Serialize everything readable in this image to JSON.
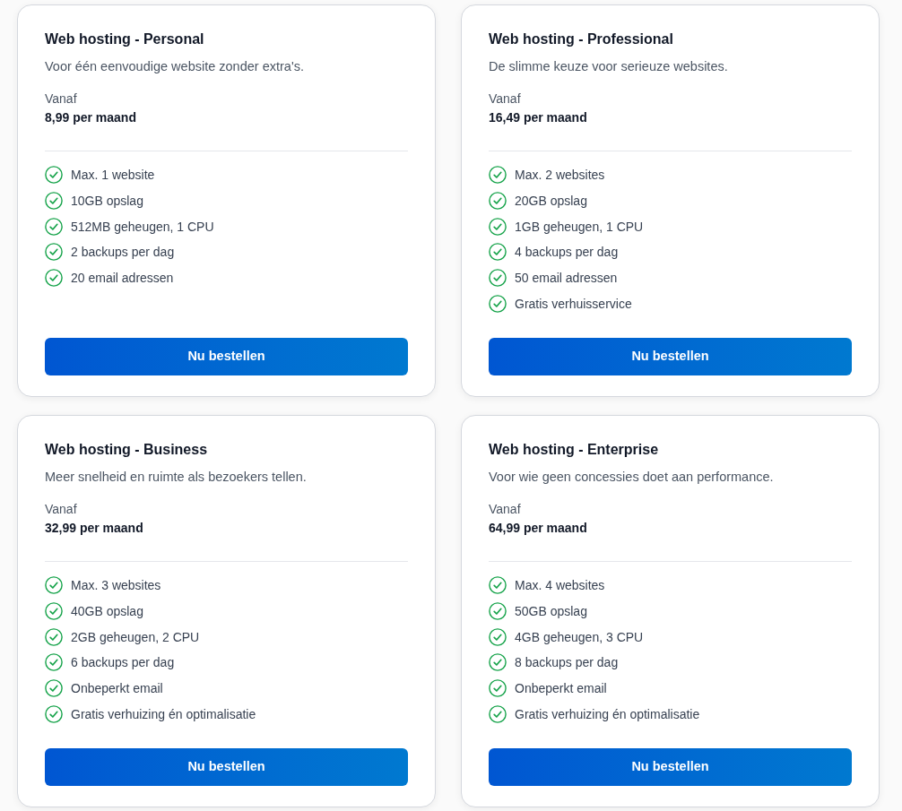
{
  "plans": [
    {
      "title": "Web hosting - Personal",
      "description": "Voor één eenvoudige website zonder extra's.",
      "price_label": "Vanaf",
      "price": "8,99 per maand",
      "features": [
        "Max. 1 website",
        "10GB opslag",
        "512MB geheugen, 1 CPU",
        "2 backups per dag",
        "20 email adressen"
      ],
      "button": "Nu bestellen"
    },
    {
      "title": "Web hosting - Professional",
      "description": "De slimme keuze voor serieuze websites.",
      "price_label": "Vanaf",
      "price": "16,49 per maand",
      "features": [
        "Max. 2 websites",
        "20GB opslag",
        "1GB geheugen, 1 CPU",
        "4 backups per dag",
        "50 email adressen",
        "Gratis verhuisservice"
      ],
      "button": "Nu bestellen"
    },
    {
      "title": "Web hosting - Business",
      "description": "Meer snelheid en ruimte als bezoekers tellen.",
      "price_label": "Vanaf",
      "price": "32,99 per maand",
      "features": [
        "Max. 3 websites",
        "40GB opslag",
        "2GB geheugen, 2 CPU",
        "6 backups per dag",
        "Onbeperkt email",
        "Gratis verhuizing én optimalisatie"
      ],
      "button": "Nu bestellen"
    },
    {
      "title": "Web hosting - Enterprise",
      "description": "Voor wie geen concessies doet aan performance.",
      "price_label": "Vanaf",
      "price": "64,99 per maand",
      "features": [
        "Max. 4 websites",
        "50GB opslag",
        "4GB geheugen, 3 CPU",
        "8 backups per dag",
        "Onbeperkt email",
        "Gratis verhuizing én optimalisatie"
      ],
      "button": "Nu bestellen"
    }
  ]
}
